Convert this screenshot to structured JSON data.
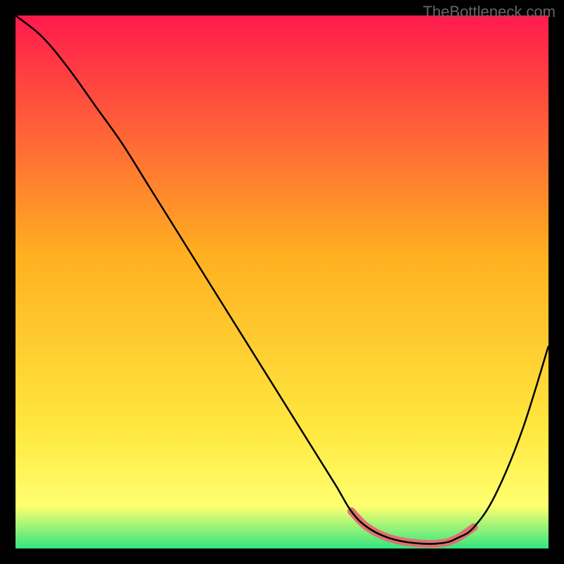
{
  "watermark": "TheBottleneck.com",
  "chart_data": {
    "type": "line",
    "title": "",
    "xlabel": "",
    "ylabel": "",
    "xlim": [
      0,
      100
    ],
    "ylim": [
      0,
      100
    ],
    "grid": false,
    "background_gradient": {
      "top": "#ff1a4d",
      "mid": "#ffd633",
      "lower": "#ffff66",
      "bottom": "#33e680"
    },
    "series": [
      {
        "name": "curve",
        "color": "#000000",
        "x": [
          0,
          5,
          10,
          15,
          20,
          25,
          30,
          35,
          40,
          45,
          50,
          55,
          60,
          63,
          66,
          70,
          75,
          80,
          83,
          86,
          90,
          95,
          100
        ],
        "y": [
          100,
          96,
          90,
          83,
          76,
          68,
          60,
          52,
          44,
          36,
          28,
          20,
          12,
          7,
          4,
          2,
          1,
          1,
          2,
          4,
          10,
          22,
          38
        ]
      },
      {
        "name": "highlight-band",
        "color": "#e07070",
        "x": [
          63,
          66,
          70,
          75,
          80,
          83,
          86
        ],
        "y": [
          7,
          4,
          2,
          1,
          1,
          2,
          4
        ]
      }
    ]
  }
}
